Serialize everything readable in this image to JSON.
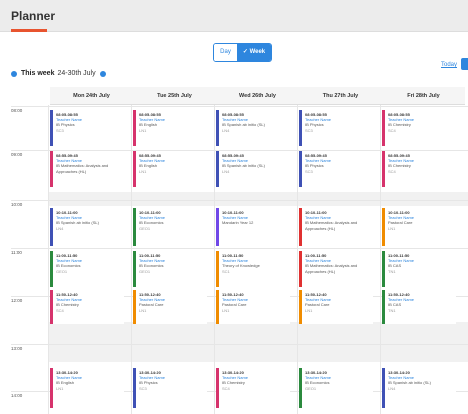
{
  "header": {
    "title": "Planner"
  },
  "toggle": {
    "day": "Day",
    "week": "Week"
  },
  "week": {
    "label": "This week",
    "range": "24-30th July"
  },
  "today_link": "Today",
  "colors": {
    "accent": "#2e86de",
    "brand": "#e8542f",
    "blue": "#3f51b5",
    "pink": "#d6336c",
    "green": "#2b8a3e",
    "purple": "#7048e8",
    "orange": "#f08c00",
    "red": "#e03131",
    "teal": "#0c8599"
  },
  "days": [
    "Mon 24th July",
    "Tue 25th July",
    "Wed 26th July",
    "Thu 27th July",
    "Fri 28th July"
  ],
  "times": [
    "08:00",
    "09:00",
    "10:00",
    "11:00",
    "12:00",
    "13:00",
    "14:00"
  ],
  "cards": [
    {
      "day": 0,
      "row": 0,
      "color": "blue",
      "time": "08:05-08:55",
      "teacher": "Teacher Name",
      "subject": "IB Physics",
      "room": "SC3"
    },
    {
      "day": 1,
      "row": 0,
      "color": "pink",
      "time": "08:05-08:55",
      "teacher": "Teacher Name",
      "subject": "IB English",
      "room": "LN1"
    },
    {
      "day": 2,
      "row": 0,
      "color": "blue",
      "time": "08:05-08:55",
      "teacher": "Teacher Name",
      "subject": "IB Spanish ab initio (SL)",
      "room": "LN4"
    },
    {
      "day": 3,
      "row": 0,
      "color": "blue",
      "time": "08:05-08:55",
      "teacher": "Teacher Name",
      "subject": "IB Physics",
      "room": "SC3"
    },
    {
      "day": 4,
      "row": 0,
      "color": "pink",
      "time": "08:05-08:55",
      "teacher": "Teacher Name",
      "subject": "IB Chemistry",
      "room": "SC4"
    },
    {
      "day": 0,
      "row": 1,
      "color": "pink",
      "time": "08:55-09:45",
      "teacher": "Teacher Name",
      "subject": "IB Mathematics: Analysis and Approaches (HL)",
      "room": ""
    },
    {
      "day": 1,
      "row": 1,
      "color": "pink",
      "time": "08:55-09:45",
      "teacher": "Teacher Name",
      "subject": "IB English",
      "room": "LN1"
    },
    {
      "day": 2,
      "row": 1,
      "color": "blue",
      "time": "08:55-09:45",
      "teacher": "Teacher Name",
      "subject": "IB Spanish ab initio (SL)",
      "room": "LN4"
    },
    {
      "day": 3,
      "row": 1,
      "color": "blue",
      "time": "08:55-09:45",
      "teacher": "Teacher Name",
      "subject": "IB Physics",
      "room": "SC3"
    },
    {
      "day": 4,
      "row": 1,
      "color": "pink",
      "time": "08:55-09:45",
      "teacher": "Teacher Name",
      "subject": "IB Chemistry",
      "room": "SC4"
    },
    {
      "day": 0,
      "row": 2,
      "color": "blue",
      "time": "10:10-11:00",
      "teacher": "Teacher Name",
      "subject": "IB Spanish ab initio (SL)",
      "room": "LN4"
    },
    {
      "day": 1,
      "row": 2,
      "color": "green",
      "time": "10:10-11:00",
      "teacher": "Teacher Name",
      "subject": "IB Economics",
      "room": "GEO1"
    },
    {
      "day": 2,
      "row": 2,
      "color": "purple",
      "time": "10:10-11:00",
      "teacher": "Teacher Name",
      "subject": "Mandarin Year 12",
      "room": ""
    },
    {
      "day": 3,
      "row": 2,
      "color": "red",
      "time": "10:10-11:00",
      "teacher": "Teacher Name",
      "subject": "IB Mathematics: Analysis and Approaches (HL)",
      "room": ""
    },
    {
      "day": 4,
      "row": 2,
      "color": "orange",
      "time": "10:10-11:00",
      "teacher": "Teacher Name",
      "subject": "Pastoral Care",
      "room": "LN1"
    },
    {
      "day": 0,
      "row": 3,
      "color": "green",
      "time": "11:00-11:50",
      "teacher": "Teacher Name",
      "subject": "IB Economics",
      "room": "GEO1"
    },
    {
      "day": 1,
      "row": 3,
      "color": "green",
      "time": "11:00-11:50",
      "teacher": "Teacher Name",
      "subject": "IB Economics",
      "room": "GEO1"
    },
    {
      "day": 2,
      "row": 3,
      "color": "orange",
      "time": "11:00-11:50",
      "teacher": "Teacher Name",
      "subject": "Theory of Knowledge",
      "room": "SC1"
    },
    {
      "day": 3,
      "row": 3,
      "color": "red",
      "time": "11:00-11:50",
      "teacher": "Teacher Name",
      "subject": "IB Mathematics: Analysis and Approaches (HL)",
      "room": ""
    },
    {
      "day": 4,
      "row": 3,
      "color": "green",
      "time": "11:00-11:50",
      "teacher": "Teacher Name",
      "subject": "IB CAS",
      "room": "TN1"
    },
    {
      "day": 0,
      "row": 4,
      "color": "pink",
      "time": "11:50-12:40",
      "teacher": "Teacher Name",
      "subject": "IB Chemistry",
      "room": "SC4"
    },
    {
      "day": 1,
      "row": 4,
      "color": "orange",
      "time": "11:50-12:40",
      "teacher": "Teacher Name",
      "subject": "Pastoral Care",
      "room": "LN1"
    },
    {
      "day": 2,
      "row": 4,
      "color": "orange",
      "time": "11:50-12:40",
      "teacher": "Teacher Name",
      "subject": "Pastoral Care",
      "room": "LN1"
    },
    {
      "day": 3,
      "row": 4,
      "color": "orange",
      "time": "11:50-12:40",
      "teacher": "Teacher Name",
      "subject": "Pastoral Care",
      "room": "LN1"
    },
    {
      "day": 4,
      "row": 4,
      "color": "green",
      "time": "11:50-12:40",
      "teacher": "Teacher Name",
      "subject": "IB CAS",
      "room": "TN1"
    },
    {
      "day": 0,
      "row": 5,
      "color": "pink",
      "time": "13:30-14:20",
      "teacher": "Teacher Name",
      "subject": "IB English",
      "room": "LN1"
    },
    {
      "day": 1,
      "row": 5,
      "color": "blue",
      "time": "13:30-14:20",
      "teacher": "Teacher Name",
      "subject": "IB Physics",
      "room": "SC3"
    },
    {
      "day": 2,
      "row": 5,
      "color": "pink",
      "time": "13:30-14:20",
      "teacher": "Teacher Name",
      "subject": "IB Chemistry",
      "room": "SC4"
    },
    {
      "day": 3,
      "row": 5,
      "color": "green",
      "time": "13:30-14:20",
      "teacher": "Teacher Name",
      "subject": "IB Economics",
      "room": "GEO1"
    },
    {
      "day": 4,
      "row": 5,
      "color": "blue",
      "time": "13:30-14:20",
      "teacher": "Teacher Name",
      "subject": "IB Spanish ab initio (SL)",
      "room": "LN4"
    }
  ]
}
